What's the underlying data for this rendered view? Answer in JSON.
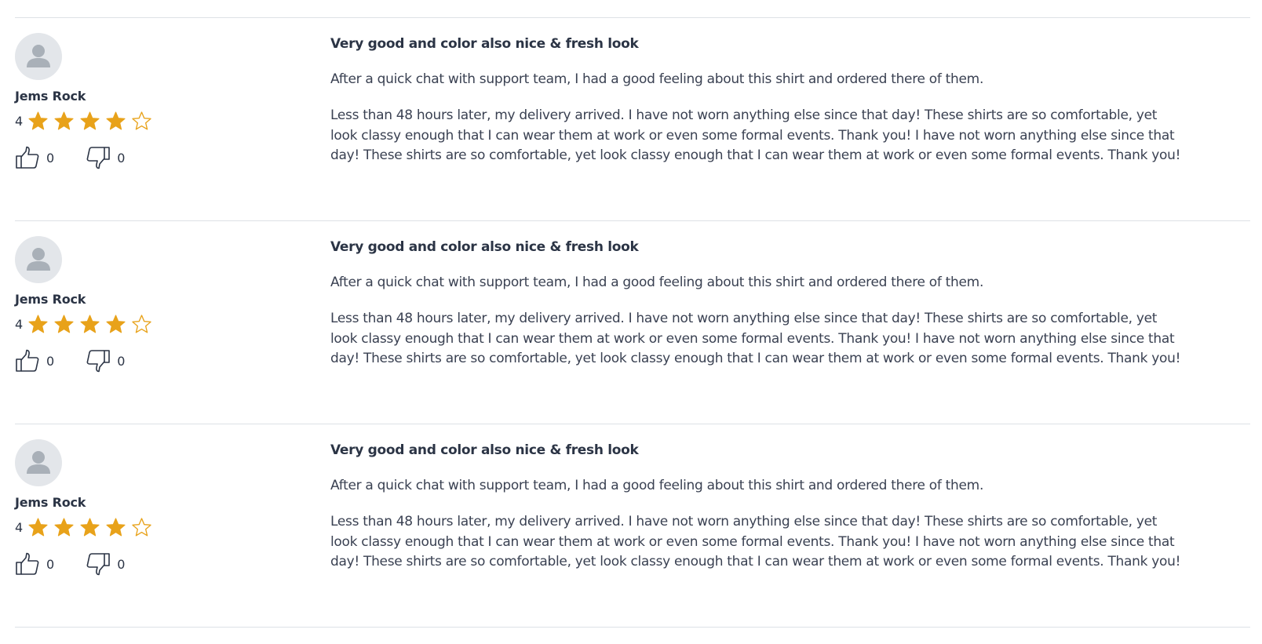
{
  "colors": {
    "star_filled": "#e8a21a",
    "star_empty_outline": "#e8a21a",
    "text": "#2b3445",
    "divider": "#dde1e6",
    "avatar_bg": "#e3e6ea",
    "avatar_figure": "#a9b0b8"
  },
  "icons": {
    "avatar": "user-silhouette-icon",
    "like": "thumbs-up-icon",
    "dislike": "thumbs-down-icon",
    "star": "star-icon"
  },
  "reviews": [
    {
      "name": "Jems Rock",
      "rating": "4",
      "stars_filled": 4,
      "stars_total": 5,
      "likes": "0",
      "dislikes": "0",
      "title": "Very good and color also nice & fresh look",
      "intro": "After a quick chat with support team, I had a good feeling about this shirt and ordered there of them.",
      "body": "Less than 48 hours later, my delivery arrived. I have not worn anything else since that day! These shirts are so comfortable, yet look classy enough that I can wear them at work or even some formal events. Thank you! I have not worn anything else since that day! These shirts are so comfortable, yet look classy enough that I can wear them at work or even some formal events. Thank you!"
    },
    {
      "name": "Jems Rock",
      "rating": "4",
      "stars_filled": 4,
      "stars_total": 5,
      "likes": "0",
      "dislikes": "0",
      "title": "Very good and color also nice & fresh look",
      "intro": "After a quick chat with support team, I had a good feeling about this shirt and ordered there of them.",
      "body": "Less than 48 hours later, my delivery arrived. I have not worn anything else since that day! These shirts are so comfortable, yet look classy enough that I can wear them at work or even some formal events. Thank you! I have not worn anything else since that day! These shirts are so comfortable, yet look classy enough that I can wear them at work or even some formal events. Thank you!"
    },
    {
      "name": "Jems Rock",
      "rating": "4",
      "stars_filled": 4,
      "stars_total": 5,
      "likes": "0",
      "dislikes": "0",
      "title": "Very good and color also nice & fresh look",
      "intro": "After a quick chat with support team, I had a good feeling about this shirt and ordered there of them.",
      "body": "Less than 48 hours later, my delivery arrived. I have not worn anything else since that day! These shirts are so comfortable, yet look classy enough that I can wear them at work or even some formal events. Thank you! I have not worn anything else since that day! These shirts are so comfortable, yet look classy enough that I can wear them at work or even some formal events. Thank you!"
    }
  ]
}
